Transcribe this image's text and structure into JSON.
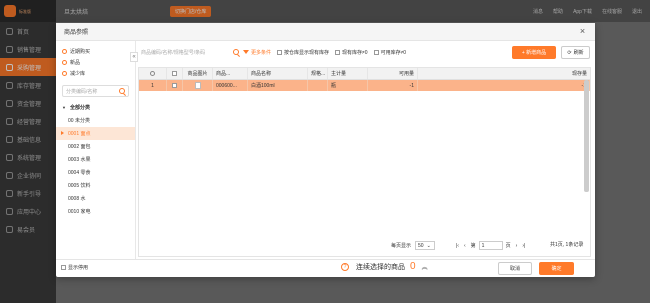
{
  "app": {
    "brand_text": "标准版",
    "store_name": "旦太烘焙",
    "switch_store_btn": "切换门店/仓库",
    "top_links": [
      "消息",
      "帮助",
      "App下载",
      "在线客服",
      "退出"
    ],
    "sidebar_items": [
      {
        "label": "首页",
        "active": false
      },
      {
        "label": "销售管理",
        "active": false
      },
      {
        "label": "采购管理",
        "active": true
      },
      {
        "label": "库存管理",
        "active": false
      },
      {
        "label": "资金管理",
        "active": false
      },
      {
        "label": "经营管理",
        "active": false
      },
      {
        "label": "基础信息",
        "active": false
      },
      {
        "label": "系统管理",
        "active": false
      },
      {
        "label": "企业协同",
        "active": false
      },
      {
        "label": "新手引导",
        "active": false
      },
      {
        "label": "应用中心",
        "active": false
      },
      {
        "label": "易会员",
        "active": false
      }
    ]
  },
  "modal": {
    "title": "商品参照",
    "close_icon": "close-icon",
    "quick_links": [
      "近期购买",
      "新品",
      "减少库"
    ],
    "category_search_placeholder": "分类编码/名称",
    "tree": {
      "root": "全部分类",
      "items": [
        {
          "label": "00 未分类",
          "selected": false
        },
        {
          "label": "0001 面点",
          "selected": true
        },
        {
          "label": "0002 面包",
          "selected": false
        },
        {
          "label": "0003 水果",
          "selected": false
        },
        {
          "label": "0004 零食",
          "selected": false
        },
        {
          "label": "0005 饮料",
          "selected": false
        },
        {
          "label": "0008 水",
          "selected": false
        },
        {
          "label": "0010 家电",
          "selected": false
        }
      ]
    },
    "toolbar": {
      "search_placeholder": "商品编码/名称/规格型号/条码",
      "more_filters": "更多条件",
      "checkboxes": [
        "按仓库显示现有库存",
        "现有库存≠0",
        "可用库存≠0"
      ],
      "add_button": "+ 新增商品",
      "refresh_button": "刷新"
    },
    "grid": {
      "headers": [
        "",
        "",
        "商品图片",
        "商品...",
        "商品名称",
        "规格...",
        "主计量",
        "可用量",
        "现存量"
      ],
      "rows": [
        {
          "index": "1",
          "checked": false,
          "code": "000600...",
          "name": "白酒100ml",
          "spec": "",
          "unit": "瓶",
          "available": "-1",
          "stock": "-1"
        }
      ]
    },
    "pager": {
      "page_size_label": "每页显示",
      "page_size": "50",
      "page_prefix": "第",
      "page_number": "1",
      "page_suffix": "页",
      "summary": "共1页, 1条记录"
    },
    "footer": {
      "stop_use_label": "显示停用",
      "selected_label": "连续选择的商品",
      "selected_count": "0",
      "cancel": "取消",
      "confirm": "确定"
    }
  }
}
